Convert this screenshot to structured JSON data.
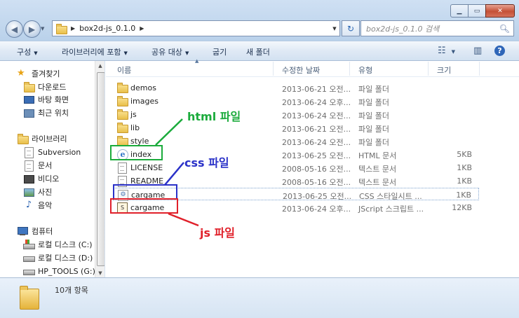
{
  "window": {
    "caption_buttons": {
      "minimize": "▁",
      "maximize": "▭",
      "close": "✕"
    }
  },
  "address": {
    "crumbs": [
      "box2d-js_0.1.0"
    ],
    "search_placeholder": "box2d-js_0.1.0 검색"
  },
  "toolbar": {
    "organize": "구성",
    "include_library": "라이브러리에 포함",
    "share": "공유 대상",
    "burn": "굽기",
    "new_folder": "새 폴더"
  },
  "nav": {
    "favorites": "즐겨찾기",
    "downloads": "다운로드",
    "desktop": "바탕 화면",
    "recent": "최근 위치",
    "libraries": "라이브러리",
    "subversion": "Subversion",
    "documents": "문서",
    "videos": "비디오",
    "pictures": "사진",
    "music": "음악",
    "computer": "컴퓨터",
    "disk_c": "로컬 디스크 (C:)",
    "disk_d": "로컬 디스크 (D:)",
    "hp_tools": "HP_TOOLS (G:)"
  },
  "columns": {
    "name": "이름",
    "modified": "수정한 날짜",
    "type": "유형",
    "size": "크기"
  },
  "files": [
    {
      "name": "demos",
      "date": "2013-06-21 오전...",
      "type": "파일 폴더",
      "size": "",
      "icon": "folder"
    },
    {
      "name": "images",
      "date": "2013-06-24 오후...",
      "type": "파일 폴더",
      "size": "",
      "icon": "folder"
    },
    {
      "name": "js",
      "date": "2013-06-24 오전...",
      "type": "파일 폴더",
      "size": "",
      "icon": "folder"
    },
    {
      "name": "lib",
      "date": "2013-06-21 오전...",
      "type": "파일 폴더",
      "size": "",
      "icon": "folder"
    },
    {
      "name": "style",
      "date": "2013-06-24 오전...",
      "type": "파일 폴더",
      "size": "",
      "icon": "folder"
    },
    {
      "name": "index",
      "date": "2013-06-25 오전...",
      "type": "HTML 문서",
      "size": "5KB",
      "icon": "ie"
    },
    {
      "name": "LICENSE",
      "date": "2008-05-16 오전...",
      "type": "텍스트 문서",
      "size": "1KB",
      "icon": "text"
    },
    {
      "name": "README",
      "date": "2008-05-16 오전...",
      "type": "텍스트 문서",
      "size": "1KB",
      "icon": "text"
    },
    {
      "name": "cargame",
      "date": "2013-06-25 오전...",
      "type": "CSS 스타일시트 ...",
      "size": "1KB",
      "icon": "css"
    },
    {
      "name": "cargame",
      "date": "2013-06-24 오후...",
      "type": "JScript 스크립트 ...",
      "size": "12KB",
      "icon": "js"
    }
  ],
  "status": {
    "count": "10개 항목"
  },
  "annotations": {
    "html_label": "html 파일",
    "css_label": "css 파일",
    "js_label": "js 파일",
    "html_color": "#1bab3c",
    "css_color": "#2a31c8",
    "js_color": "#e0202a"
  }
}
